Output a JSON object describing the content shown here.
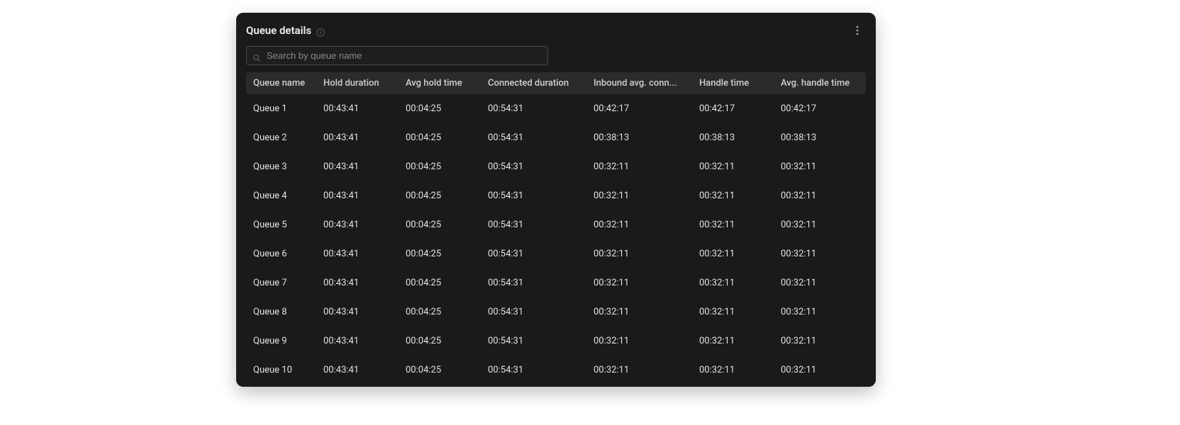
{
  "header": {
    "title": "Queue details"
  },
  "search": {
    "placeholder": "Search by queue name",
    "value": ""
  },
  "columns": [
    "Queue name",
    "Hold duration",
    "Avg hold time",
    "Connected duration",
    "Inbound avg. conn...",
    "Handle time",
    "Avg. handle time"
  ],
  "rows": [
    {
      "name": "Queue 1",
      "hold": "00:43:41",
      "avg_hold": "00:04:25",
      "connected": "00:54:31",
      "inbound_avg": "00:42:17",
      "handle": "00:42:17",
      "avg_handle": "00:42:17"
    },
    {
      "name": "Queue 2",
      "hold": "00:43:41",
      "avg_hold": "00:04:25",
      "connected": "00:54:31",
      "inbound_avg": "00:38:13",
      "handle": "00:38:13",
      "avg_handle": "00:38:13"
    },
    {
      "name": "Queue 3",
      "hold": "00:43:41",
      "avg_hold": "00:04:25",
      "connected": "00:54:31",
      "inbound_avg": "00:32:11",
      "handle": "00:32:11",
      "avg_handle": "00:32:11"
    },
    {
      "name": "Queue 4",
      "hold": "00:43:41",
      "avg_hold": "00:04:25",
      "connected": "00:54:31",
      "inbound_avg": "00:32:11",
      "handle": "00:32:11",
      "avg_handle": "00:32:11"
    },
    {
      "name": "Queue 5",
      "hold": "00:43:41",
      "avg_hold": "00:04:25",
      "connected": "00:54:31",
      "inbound_avg": "00:32:11",
      "handle": "00:32:11",
      "avg_handle": "00:32:11"
    },
    {
      "name": "Queue 6",
      "hold": "00:43:41",
      "avg_hold": "00:04:25",
      "connected": "00:54:31",
      "inbound_avg": "00:32:11",
      "handle": "00:32:11",
      "avg_handle": "00:32:11"
    },
    {
      "name": "Queue 7",
      "hold": "00:43:41",
      "avg_hold": "00:04:25",
      "connected": "00:54:31",
      "inbound_avg": "00:32:11",
      "handle": "00:32:11",
      "avg_handle": "00:32:11"
    },
    {
      "name": "Queue 8",
      "hold": "00:43:41",
      "avg_hold": "00:04:25",
      "connected": "00:54:31",
      "inbound_avg": "00:32:11",
      "handle": "00:32:11",
      "avg_handle": "00:32:11"
    },
    {
      "name": "Queue 9",
      "hold": "00:43:41",
      "avg_hold": "00:04:25",
      "connected": "00:54:31",
      "inbound_avg": "00:32:11",
      "handle": "00:32:11",
      "avg_handle": "00:32:11"
    },
    {
      "name": "Queue 10",
      "hold": "00:43:41",
      "avg_hold": "00:04:25",
      "connected": "00:54:31",
      "inbound_avg": "00:32:11",
      "handle": "00:32:11",
      "avg_handle": "00:32:11"
    }
  ]
}
